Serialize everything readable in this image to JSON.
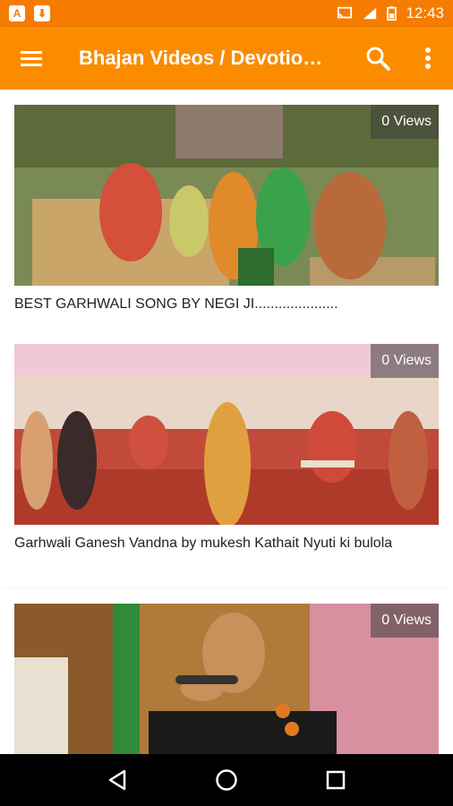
{
  "status_bar": {
    "time": "12:43",
    "left_icons": [
      "a-icon",
      "download-icon"
    ],
    "right_icons": [
      "cast-icon",
      "signal-lte-icon",
      "battery-icon"
    ]
  },
  "app_bar": {
    "title": "Bhajan Videos / Devotio…",
    "background": "#fb8c00"
  },
  "videos": [
    {
      "views": "0 Views",
      "title": "BEST GARHWALI SONG BY NEGI JI....................."
    },
    {
      "views": "0 Views",
      "title": "Garhwali Ganesh Vandna by mukesh Kathait   Nyuti ki bulola"
    },
    {
      "views": "0 Views",
      "title": ""
    }
  ],
  "colors": {
    "status_bar": "#f57c00",
    "app_bar": "#fb8c00",
    "nav_bar": "#000000"
  }
}
